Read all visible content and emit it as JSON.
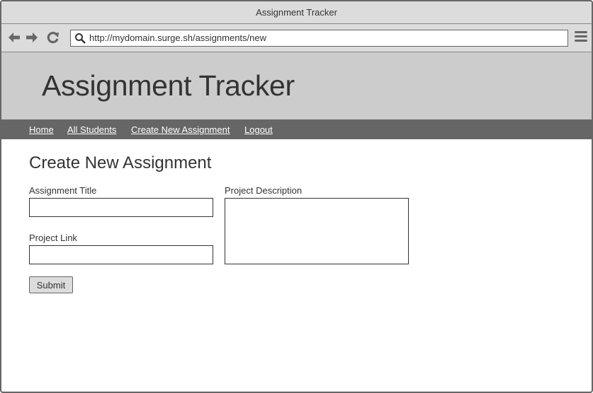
{
  "window": {
    "title": "Assignment Tracker"
  },
  "browser": {
    "url": "http://mydomain.surge.sh/assignments/new",
    "icons": {
      "back": "arrow-left-icon",
      "forward": "arrow-right-icon",
      "reload": "reload-icon",
      "search": "search-icon",
      "menu": "hamburger-menu-icon"
    }
  },
  "header": {
    "title": "Assignment Tracker"
  },
  "nav": {
    "items": [
      {
        "label": "Home"
      },
      {
        "label": "All Students"
      },
      {
        "label": "Create New Assignment"
      },
      {
        "label": "Logout"
      }
    ]
  },
  "form": {
    "heading": "Create New Assignment",
    "assignment_title": {
      "label": "Assignment Title",
      "value": ""
    },
    "project_link": {
      "label": "Project Link",
      "value": ""
    },
    "project_description": {
      "label": "Project Description",
      "value": ""
    },
    "submit_label": "Submit"
  },
  "colors": {
    "chrome": "#dcdcdc",
    "hero": "#cccccc",
    "navbar": "#666666",
    "text": "#333333"
  }
}
